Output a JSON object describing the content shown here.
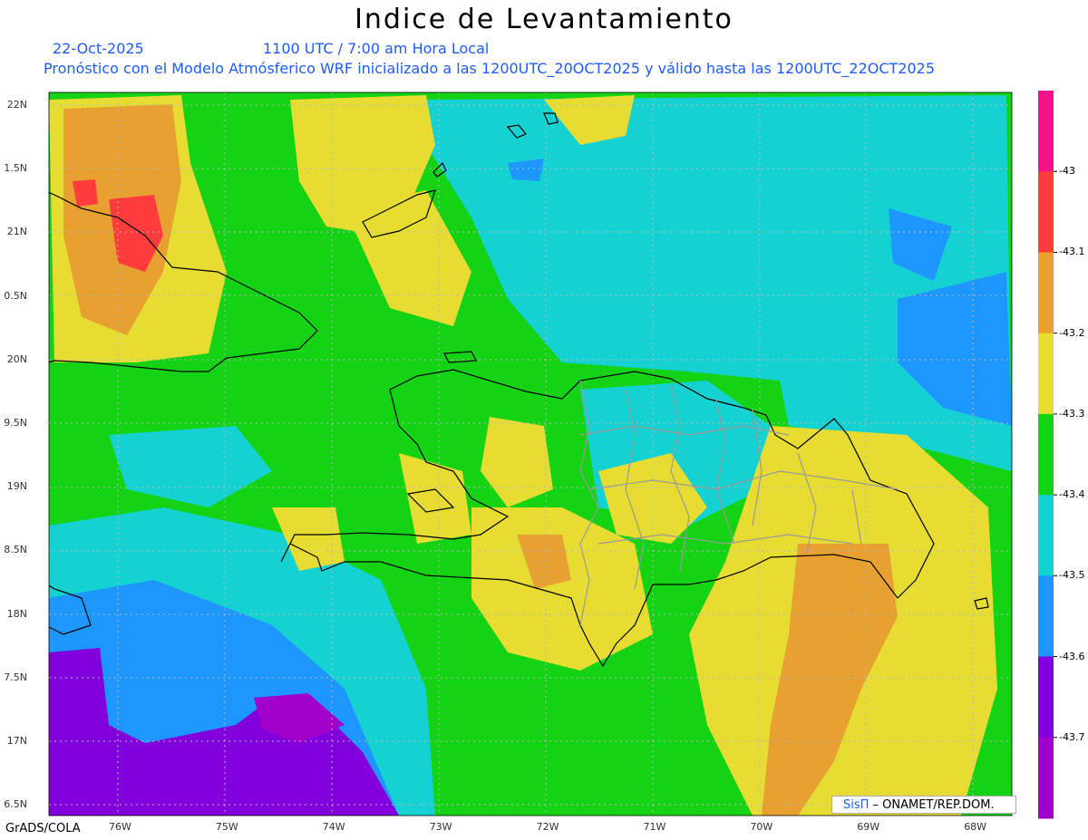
{
  "title": "Indice de Levantamiento",
  "date": "22-Oct-2025",
  "time": "1100 UTC / 7:00 am Hora Local",
  "description": "Pronóstico con el Modelo Atmósferico WRF inicializado a las 1200UTC_20OCT2025 y válido hasta las  1200UTC_22OCT2025",
  "lat_labels": [
    "22N",
    "1.5N",
    "21N",
    "0.5N",
    "20N",
    "9.5N",
    "19N",
    "8.5N",
    "18N",
    "7.5N",
    "17N",
    "6.5N"
  ],
  "lon_labels": [
    "76W",
    "75W",
    "74W",
    "73W",
    "72W",
    "71W",
    "70W",
    "69W",
    "68W"
  ],
  "colorbar": {
    "labels": [
      "-43",
      "-43.1",
      "-43.2",
      "-43.3",
      "-43.4",
      "-43.5",
      "-43.6",
      "-43.7"
    ],
    "colors": [
      "#f0148c",
      "#ff3c3c",
      "#e8a030",
      "#e6dc32",
      "#14d214",
      "#14d2d2",
      "#1e96ff",
      "#8200dc",
      "#a000c8"
    ]
  },
  "credit": "GrADS/COLA",
  "logo": {
    "sis": "SisΠ",
    "text": " – ONAMET/REP.DOM."
  }
}
